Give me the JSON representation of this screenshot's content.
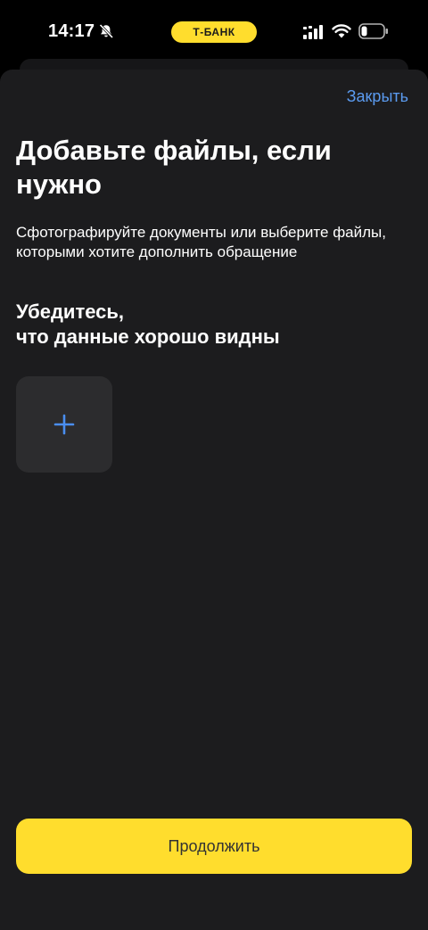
{
  "status_bar": {
    "time": "14:17",
    "carrier_pill": "Т-БАНК",
    "icons": [
      "bell-slash-icon",
      "signal-icon",
      "wifi-icon",
      "battery-icon"
    ]
  },
  "header": {
    "close_label": "Закрыть"
  },
  "main": {
    "title": "Добавьте файлы, если нужно",
    "subtitle": "Сфотографируйте документы или выберите файлы, которыми хотите дополнить обращение",
    "section_title_line1": "Убедитесь,",
    "section_title_line2": "что данные хорошо видны",
    "add_icon": "plus-icon"
  },
  "footer": {
    "continue_label": "Продолжить"
  },
  "colors": {
    "accent": "#ffdd2d",
    "link": "#5b9bf0",
    "sheet_bg": "#1c1c1e",
    "tile_bg": "#2c2c2e"
  }
}
